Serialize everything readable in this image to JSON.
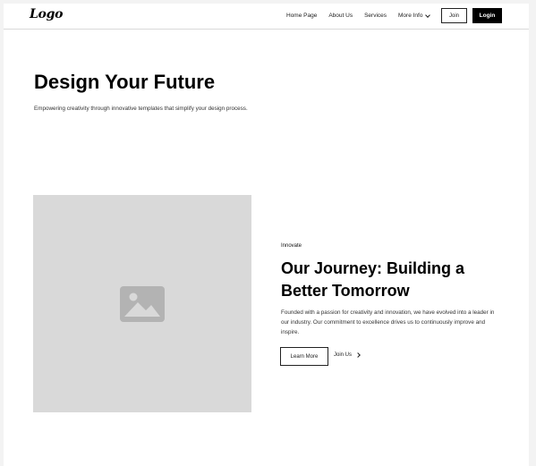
{
  "nav": {
    "logo": "Logo",
    "links": [
      "Home Page",
      "About Us",
      "Services",
      "More Info"
    ],
    "join_label": "Join",
    "login_label": "Login"
  },
  "hero": {
    "title": "Design Your Future",
    "subtitle": "Empowering creativity through innovative templates that simplify your design process."
  },
  "feature": {
    "image_icon": "image-icon",
    "tagline": "Innovate",
    "title": "Our Journey: Building a Better Tomorrow",
    "body": "Founded with a passion for creativity and innovation, we have evolved into a leader in our industry. Our commitment to excellence drives us to continuously improve and inspire.",
    "primary_button": "Learn More",
    "secondary_link": "Join Us"
  },
  "colors": {
    "accent": "#000000",
    "placeholder": "#d9d9d9",
    "placeholder_icon": "#b3b3b3"
  }
}
